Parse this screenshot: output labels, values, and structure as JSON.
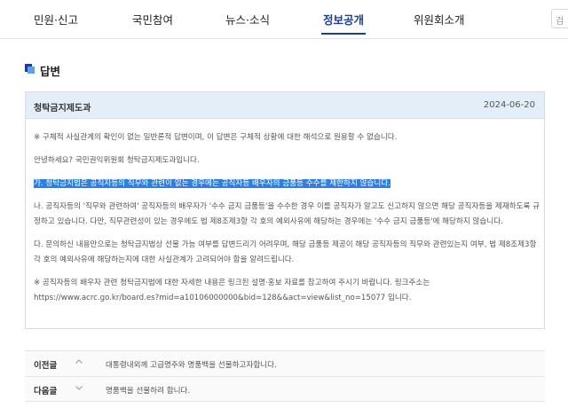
{
  "nav": {
    "items": [
      {
        "label": "민원·신고"
      },
      {
        "label": "국민참여"
      },
      {
        "label": "뉴스·소식"
      },
      {
        "label": "정보공개"
      },
      {
        "label": "위원회소개"
      }
    ],
    "active_index": 3,
    "search_placeholder": "검"
  },
  "section": {
    "title": "답변"
  },
  "answer": {
    "category": "청탁금지제도과",
    "date": "2024-06-20",
    "notice": "※ 구체적 사실관계의 확인이 없는 일반론적 답변이며, 이 답변은 구체적 상황에 대한 해석으로 원용할 수 없습니다.",
    "greeting": "안녕하세요? 국민권익위원회 청탁금지제도과입니다.",
    "highlight": "가. 청탁금지법은 공직자등의 직무와 관련이 없는 경우에는 공직자등 배우자의 금품등 수수를 제한하지 않습니다.",
    "para_b": "나. 공직자등의 '직무와 관련하여' 공직자등의 배우자가 '수수 금지 금품등'을 수수한 경우 이를 공직자가 알고도 신고하지 않으면 해당 공직자등을 제재하도록 규정하고 있습니다. 다만, 직무관련성이 있는 경우에도 법 제8조제3항 각 호의 예외사유에 해당하는 경우에는 '수수 금지 금품등'에 해당하지 않습니다.",
    "para_c": "다. 문의하신 내용만으로는 청탁금지법상 선물 가능 여부를 답변드리기 어려우며, 해당 금품등 제공이 해당 공직자등의 직무와 관련있는지 여부, 법 제8조제3항 각 호의 예외사유에 해당하는지에 대한 사실관계가 고려되어야 함을 알려드립니다.",
    "para_ref": "※ 공직자등의 배우자 관련 청탁금지법에 대한 자세한 내용은 링크된 설명·홍보 자료를 참고하여 주시기 바랍니다. 링크주소는 https://www.acrc.go.kr/board.es?mid=a10106000000&bid=128&&act=view&list_no=15077 입니다."
  },
  "prev": {
    "label": "이전글",
    "title": "대통령내외께 고급명주와 명품백을 선물하고자합니다."
  },
  "next": {
    "label": "다음글",
    "title": "명품백을 선물하려 합니다."
  },
  "icons": {
    "section": "square-bullet-icon",
    "prev": "chevron-up-icon",
    "next": "chevron-down-icon"
  }
}
